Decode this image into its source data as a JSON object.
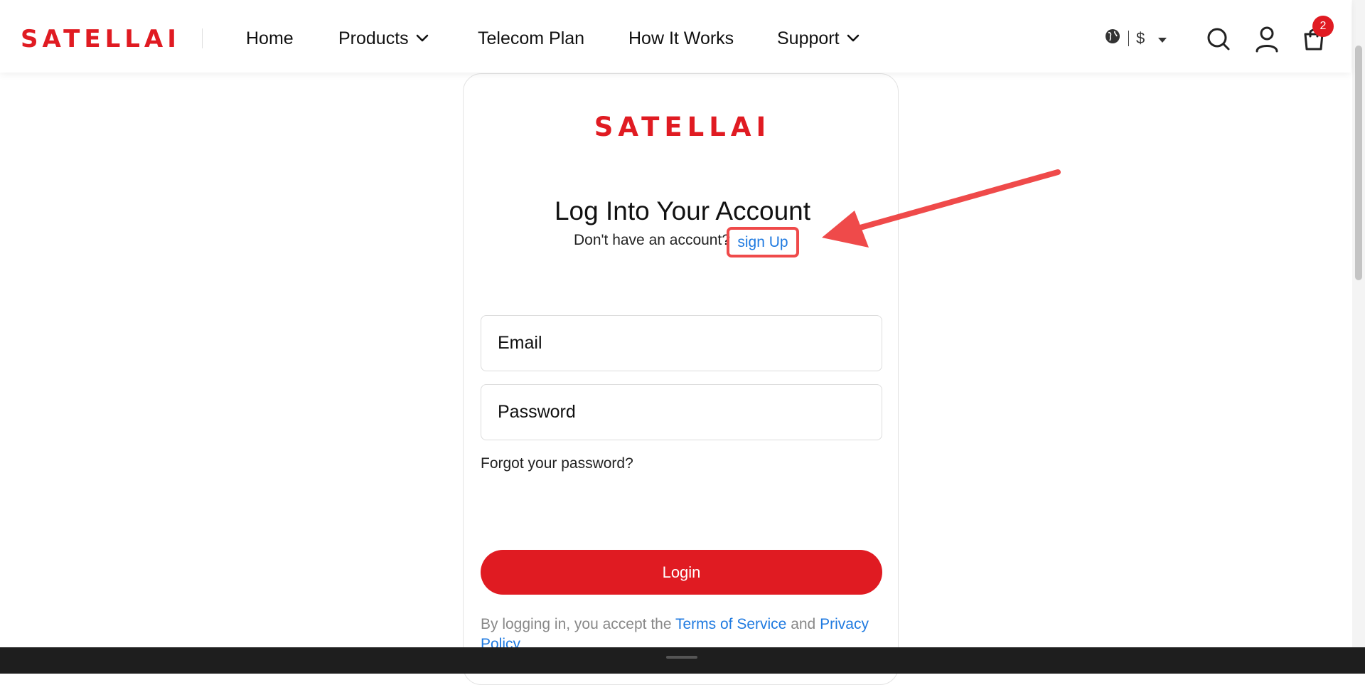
{
  "header": {
    "logo_text": "SATELLAI",
    "nav": [
      {
        "label": "Home",
        "has_dropdown": false
      },
      {
        "label": "Products",
        "has_dropdown": true
      },
      {
        "label": "Telecom Plan",
        "has_dropdown": false
      },
      {
        "label": "How It Works",
        "has_dropdown": false
      },
      {
        "label": "Support",
        "has_dropdown": true
      }
    ],
    "currency_symbol": "$",
    "cart_count": "2",
    "icons": [
      "globe-icon",
      "caret-down-icon",
      "search-icon",
      "user-icon",
      "cart-icon"
    ]
  },
  "login": {
    "logo_text": "SATELLAI",
    "title": "Log Into Your Account",
    "no_account_text": "Don't have an account?",
    "signup_link": "sign Up",
    "email_placeholder": "Email",
    "password_placeholder": "Password",
    "forgot_password": "Forgot your password?",
    "login_button": "Login",
    "terms_prefix": "By logging in, you accept the",
    "terms_link": "Terms of Service",
    "terms_and": "and",
    "privacy_link": "Privacy Policy"
  },
  "colors": {
    "brand_red": "#e01b22",
    "link_blue": "#1f7ae0",
    "annotation_red": "#ef4a4a"
  }
}
